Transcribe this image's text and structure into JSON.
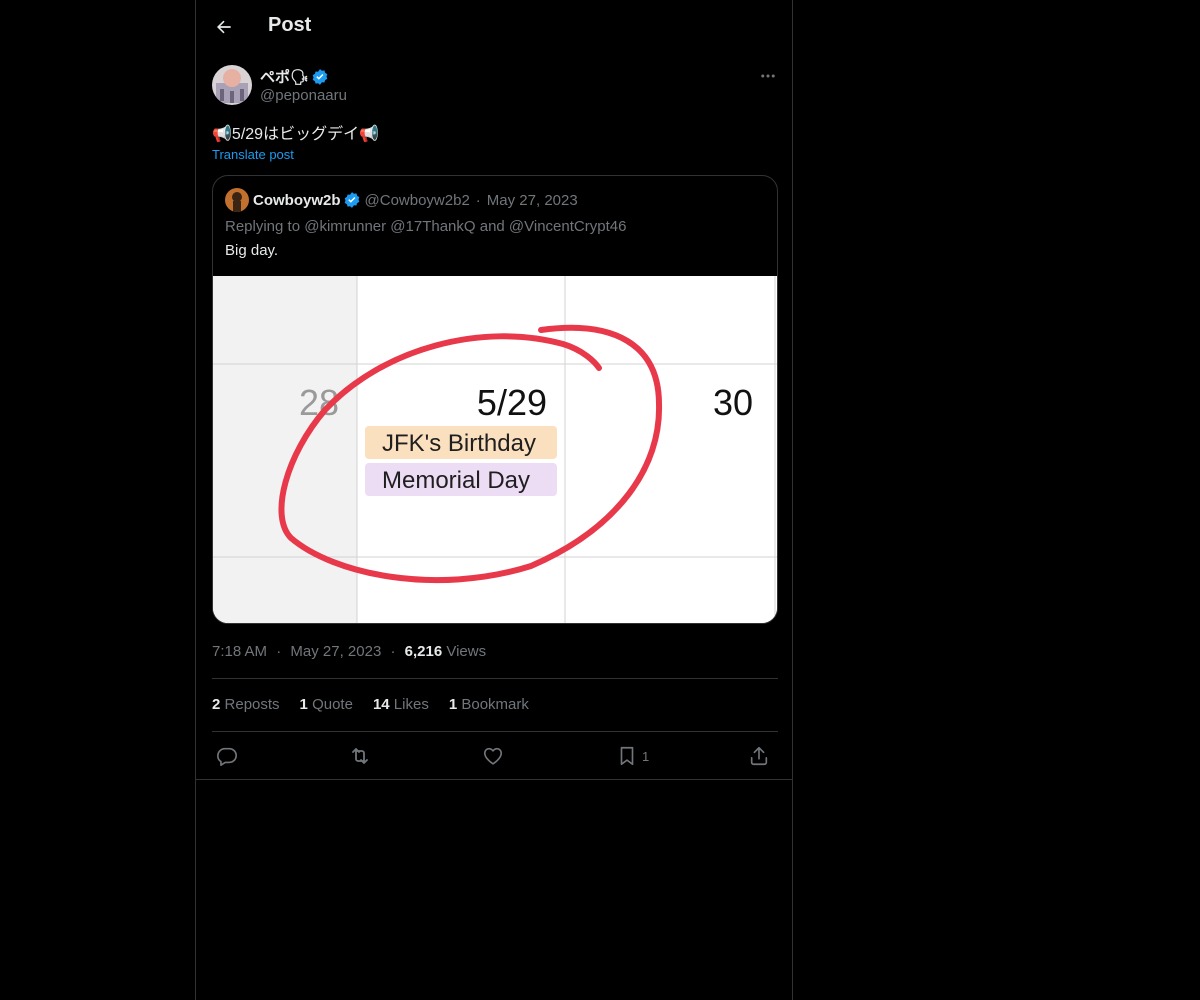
{
  "header": {
    "title": "Post"
  },
  "post": {
    "author_name": "ペポ🗣",
    "author_handle": "@peponaaru",
    "text": "📢5/29はビッグデイ📢",
    "translate_label": "Translate post",
    "time": "7:18 AM",
    "date": "May 27, 2023",
    "views_count": "6,216",
    "views_label": "Views"
  },
  "quote": {
    "name": "Cowboyw2b",
    "handle": "@Cowboyw2b2",
    "separator": "·",
    "date": "May 27, 2023",
    "replying_to": "Replying to @kimrunner @17ThankQ and @VincentCrypt46",
    "text": "Big day.",
    "media": {
      "day_prev": "28",
      "day_main": "5/29",
      "day_next": "30",
      "event1": "JFK's Birthday",
      "event2": "Memorial Day"
    }
  },
  "meta_separator": "·",
  "stats": {
    "reposts_count": "2",
    "reposts_label": "Reposts",
    "quotes_count": "1",
    "quotes_label": "Quote",
    "likes_count": "14",
    "likes_label": "Likes",
    "bookmarks_count": "1",
    "bookmarks_label": "Bookmark"
  },
  "actions": {
    "bookmark_count": "1"
  },
  "colors": {
    "accent": "#1d9bf0",
    "verified": "#1d9bf0",
    "circle": "#e8394b"
  }
}
